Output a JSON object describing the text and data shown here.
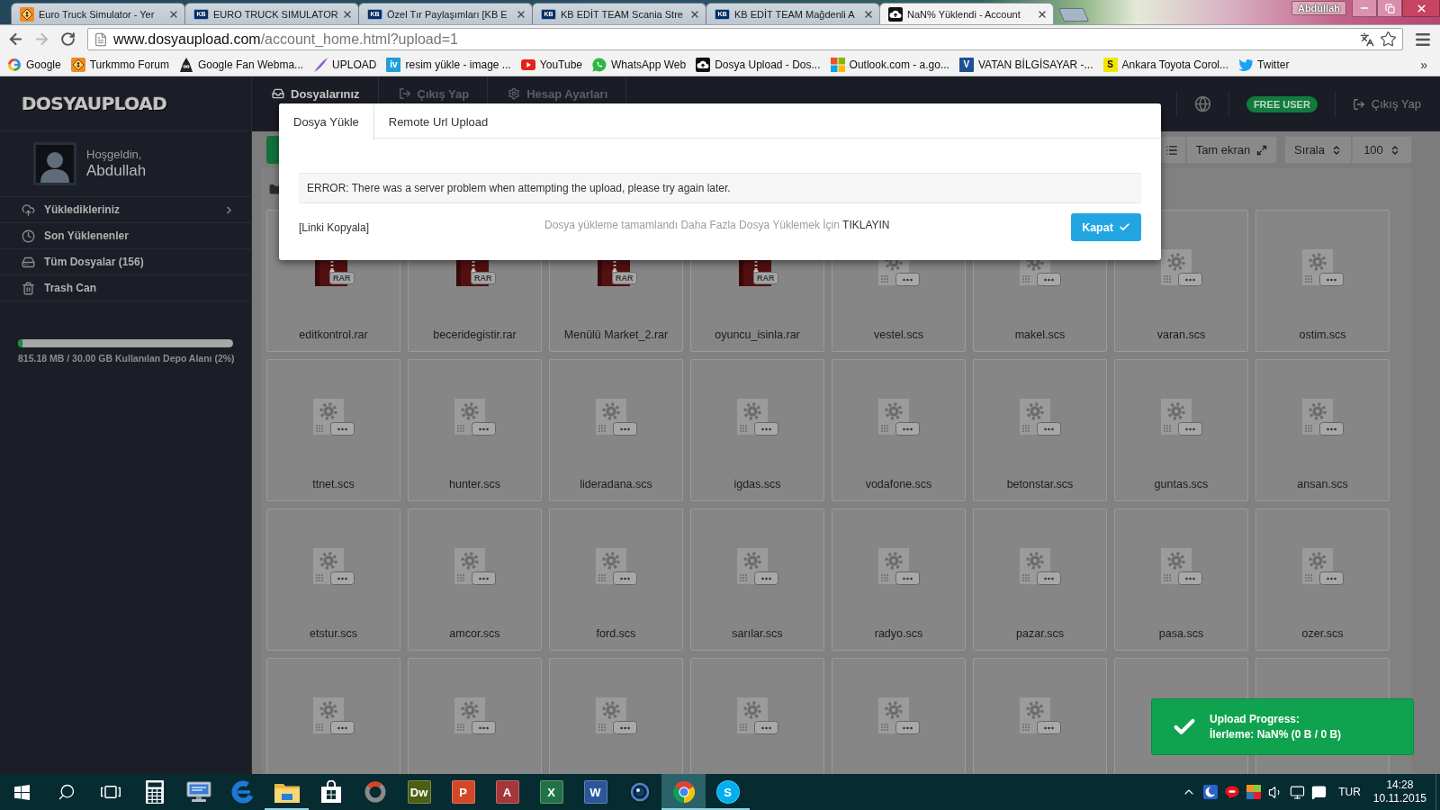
{
  "browser": {
    "tabs": [
      {
        "title": "Euro Truck Simulator - Yer",
        "kind": "hazard",
        "selected": false
      },
      {
        "title": "EURO TRUCK SIMULATOR",
        "kind": "badge",
        "badge": "KB",
        "selected": false
      },
      {
        "title": "Özel Tır Paylaşımları [KB E",
        "kind": "badge",
        "badge": "KB",
        "selected": false
      },
      {
        "title": "KB EDİT TEAM Scania Stre",
        "kind": "badge",
        "badge": "KB",
        "selected": false
      },
      {
        "title": "KB EDİT TEAM Mağdenli A",
        "kind": "badge",
        "badge": "KB",
        "selected": false
      },
      {
        "title": "NaN% Yüklendi - Account",
        "kind": "cloud",
        "selected": true
      }
    ],
    "profile": "Abdullah",
    "nav_buttons": [
      {
        "kind": "back",
        "disabled": false
      },
      {
        "kind": "forward",
        "disabled": true
      },
      {
        "kind": "reload",
        "disabled": false
      }
    ],
    "url": {
      "host": "www.dosyaupload.com",
      "path": "/account_home.html?upload=1"
    },
    "bookmarks": [
      {
        "label": "Google",
        "kind": "ring"
      },
      {
        "label": "Turkmmo Forum",
        "kind": "hazard"
      },
      {
        "label": "Google Fan Webma...",
        "kind": "hat"
      },
      {
        "label": "UPLOAD",
        "kind": "feather"
      },
      {
        "label": "resim yükle - image ...",
        "kind": "badge",
        "badge": "iv",
        "color": "#1e9fd8"
      },
      {
        "label": "YouTube",
        "kind": "play"
      },
      {
        "label": "WhatsApp Web",
        "kind": "chat"
      },
      {
        "label": "Dosya Upload - Dos...",
        "kind": "cloud"
      },
      {
        "label": "Outlook.com - a.go...",
        "kind": "squares"
      },
      {
        "label": "VATAN BİLGİSAYAR -...",
        "kind": "badge",
        "badge": "V",
        "color": "#1d4f91"
      },
      {
        "label": "Ankara Toyota Corol...",
        "kind": "badge",
        "badge": "S",
        "color": "#f2e600"
      },
      {
        "label": "Twitter",
        "kind": "bird"
      }
    ],
    "more": "»"
  },
  "site": {
    "logo": "DOSYAUPLOAD",
    "welcome": "Hoşgeldin,",
    "user": "Abdullah",
    "menu": [
      {
        "label": "Yükledikleriniz",
        "kind": "upload",
        "has_submenu": true
      },
      {
        "label": "Son Yüklenenler",
        "kind": "clock",
        "has_submenu": false
      },
      {
        "label": "Tüm Dosyalar (156)",
        "kind": "drive",
        "has_submenu": false
      },
      {
        "label": "Trash Can",
        "kind": "trash",
        "has_submenu": false
      }
    ],
    "storage": {
      "level": 0.02,
      "label": "815.18 MB / 30.00 GB Kullanılan Depo Alanı (2%)"
    },
    "nav": [
      {
        "label": "Dosyalarınız",
        "kind": "inbox",
        "selected": true
      },
      {
        "label": "Çıkış Yap",
        "kind": "logout",
        "selected": false
      },
      {
        "label": "Hesap Ayarları",
        "kind": "gear",
        "selected": false
      }
    ],
    "plan_badge": "FREE USER",
    "logout": "Çıkış Yap",
    "toolbar": {
      "fullscreen": "Tam ekran",
      "sort": "Sırala",
      "page_size": "100"
    },
    "files": [
      {
        "name": "editkontrol.rar",
        "kind": "rar",
        "badge": "RAR"
      },
      {
        "name": "beceridegistir.rar",
        "kind": "rar",
        "badge": "RAR"
      },
      {
        "name": "Menülü Market_2.rar",
        "kind": "rar",
        "badge": "RAR"
      },
      {
        "name": "oyuncu_isinla.rar",
        "kind": "rar",
        "badge": "RAR"
      },
      {
        "name": "vestel.scs",
        "kind": "scs"
      },
      {
        "name": "makel.scs",
        "kind": "scs"
      },
      {
        "name": "varan.scs",
        "kind": "scs"
      },
      {
        "name": "ostim.scs",
        "kind": "scs"
      },
      {
        "name": "ttnet.scs",
        "kind": "scs"
      },
      {
        "name": "hunter.scs",
        "kind": "scs"
      },
      {
        "name": "lideradana.scs",
        "kind": "scs"
      },
      {
        "name": "igdas.scs",
        "kind": "scs"
      },
      {
        "name": "vodafone.scs",
        "kind": "scs"
      },
      {
        "name": "betonstar.scs",
        "kind": "scs"
      },
      {
        "name": "guntas.scs",
        "kind": "scs"
      },
      {
        "name": "ansan.scs",
        "kind": "scs"
      },
      {
        "name": "etstur.scs",
        "kind": "scs"
      },
      {
        "name": "amcor.scs",
        "kind": "scs"
      },
      {
        "name": "ford.scs",
        "kind": "scs"
      },
      {
        "name": "sarılar.scs",
        "kind": "scs"
      },
      {
        "name": "radyo.scs",
        "kind": "scs"
      },
      {
        "name": "pazar.scs",
        "kind": "scs"
      },
      {
        "name": "pasa.scs",
        "kind": "scs"
      },
      {
        "name": "ozer.scs",
        "kind": "scs"
      },
      {
        "kind": "scs"
      },
      {
        "kind": "scs"
      },
      {
        "kind": "scs"
      },
      {
        "kind": "scs"
      },
      {
        "kind": "scs"
      },
      {
        "kind": "scs"
      },
      {
        "kind": "blank"
      },
      {
        "kind": "blank"
      }
    ]
  },
  "modal": {
    "tabs": [
      {
        "label": "Dosya Yükle",
        "selected": true
      },
      {
        "label": "Remote Url Upload",
        "selected": false
      }
    ],
    "error": "ERROR: There was a server problem when attempting the upload, please try again later.",
    "copy_link": "[Linki Kopyala]",
    "message": "Dosya yükleme tamamlandı Daha Fazla Dosya Yüklemek İçin",
    "link": "TIKLAYIN",
    "close_button": "Kapat"
  },
  "toast": {
    "title": "Upload Progress:",
    "text": "İlerleme: NaN% (0 B / 0 B)"
  },
  "taskbar": {
    "apps": [
      {
        "kind": "start",
        "running": false,
        "selected": false
      },
      {
        "kind": "search",
        "running": false,
        "selected": false
      },
      {
        "kind": "taskview",
        "running": false,
        "selected": false
      },
      {
        "kind": "calculator",
        "running": false,
        "selected": false
      },
      {
        "kind": "computer",
        "running": false,
        "selected": false
      },
      {
        "kind": "ring",
        "running": false,
        "selected": false
      },
      {
        "kind": "folder",
        "running": true,
        "selected": false
      },
      {
        "kind": "bag",
        "running": false,
        "selected": false
      },
      {
        "kind": "dial",
        "running": false,
        "selected": false
      },
      {
        "kind": "tile",
        "label": "Dw",
        "color": "#4d5f12",
        "running": false,
        "selected": false
      },
      {
        "kind": "tile",
        "label": "P",
        "color": "#d24726",
        "running": false,
        "selected": false
      },
      {
        "kind": "tile",
        "label": "A",
        "color": "#a4373a",
        "running": false,
        "selected": false
      },
      {
        "kind": "tile",
        "label": "X",
        "color": "#217346",
        "running": false,
        "selected": false
      },
      {
        "kind": "tile",
        "label": "W",
        "color": "#2b579a",
        "running": false,
        "selected": false
      },
      {
        "kind": "lens",
        "running": false,
        "selected": false
      },
      {
        "kind": "segments",
        "running": true,
        "selected": true
      },
      {
        "kind": "round",
        "label": "S",
        "color": "#00aff0",
        "running": true,
        "selected": false
      }
    ],
    "tray": [
      {
        "kind": "chevron"
      },
      {
        "kind": "crescent"
      },
      {
        "kind": "bubble"
      },
      {
        "kind": "quadrants"
      },
      {
        "kind": "speaker"
      },
      {
        "kind": "network"
      },
      {
        "kind": "notes"
      }
    ],
    "language": "TUR",
    "time": "14:28",
    "date": "10.11.2015"
  }
}
